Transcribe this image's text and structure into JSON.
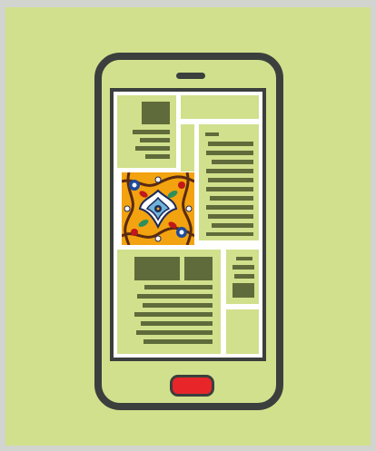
{
  "illustration": {
    "subject": "smartphone-with-article-layout",
    "icons": [
      "phone-icon",
      "speaker-grille-icon",
      "home-button-icon",
      "ornamental-tile-image"
    ],
    "colors": {
      "background": "#d1e08c",
      "outline": "#3b3f3d",
      "content_blocks": "#5f6b3a",
      "home_button": "#e8262a",
      "screen_gaps": "#ffffff"
    }
  }
}
